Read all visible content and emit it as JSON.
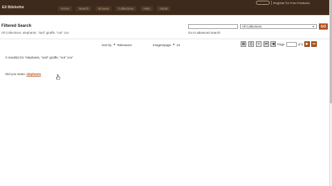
{
  "topbar": {
    "brand": "Ell Bibliothè",
    "nav": [
      "Home",
      "Search",
      "Browse",
      "Collections",
      "Help",
      "About"
    ],
    "util_text": "Register for Free Features"
  },
  "page": {
    "title": "Filtered Search",
    "criteria": "All Collections: elephants, \"and\" giraffe, \"not\" zoo"
  },
  "search": {
    "placeholder": "",
    "collection_selected": "All Collections",
    "go_label": "GO",
    "advanced_link": "Go to advanced search"
  },
  "toolbar": {
    "sort_label": "Sort by",
    "sort_value": "Relevance",
    "per_page_label": "Images/page",
    "per_page_value": "24",
    "page_label": "Page",
    "page_of": "of 0"
  },
  "results": {
    "count_text": "0 result(s) for \"elephants, \"and\" giraffe, \"not\" zoo\"",
    "suggest_label": "Did you mean:",
    "suggest_term": "elephants"
  },
  "icons": {
    "tool1": "grid-view-icon",
    "tool2": "print-icon",
    "tool3": "list-view-icon",
    "first": "first-page-icon",
    "prev": "prev-page-icon",
    "next": "next-page-icon",
    "last": "last-page-icon"
  },
  "colors": {
    "header_bg": "#3d2a1c",
    "accent": "#b0531f"
  }
}
